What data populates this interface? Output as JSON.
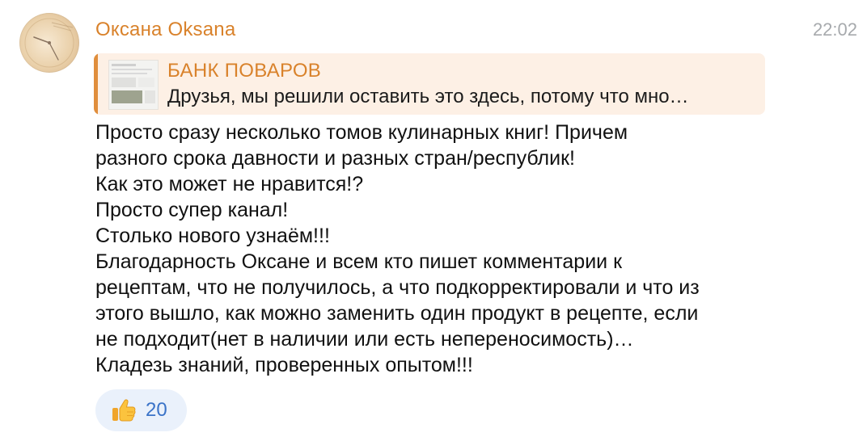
{
  "message": {
    "author": "Оксана Oksana",
    "time": "22:02",
    "reply": {
      "title": "БАНК ПОВАРОВ",
      "text": "Друзья, мы решили оставить это здесь, потому что мно…"
    },
    "body_lines": [
      "Просто сразу несколько томов кулинарных книг! Причем",
      "разного срока давности и разных стран/республик!",
      "Как это может не нравится!?",
      "Просто супер канал!",
      "Столько нового узнаём!!!",
      "Благодарность Оксане и всем кто пишет комментарии к",
      "рецептам, что не получилось, а что подкорректировали и что из",
      "этого вышло, как можно заменить один продукт в рецепте, если",
      "не подходит(нет в наличии или есть непереносимость)…",
      "Кладезь знаний, проверенных опытом!!!"
    ],
    "reaction": {
      "icon": "thumbs-up",
      "count": "20"
    }
  },
  "colors": {
    "author": "#d9822b",
    "reply_background": "#fdf0e5",
    "reply_bar": "#e08e3c",
    "reaction_background": "#eaf1fb",
    "reaction_count": "#3a73c8",
    "time": "#a7aaad"
  }
}
